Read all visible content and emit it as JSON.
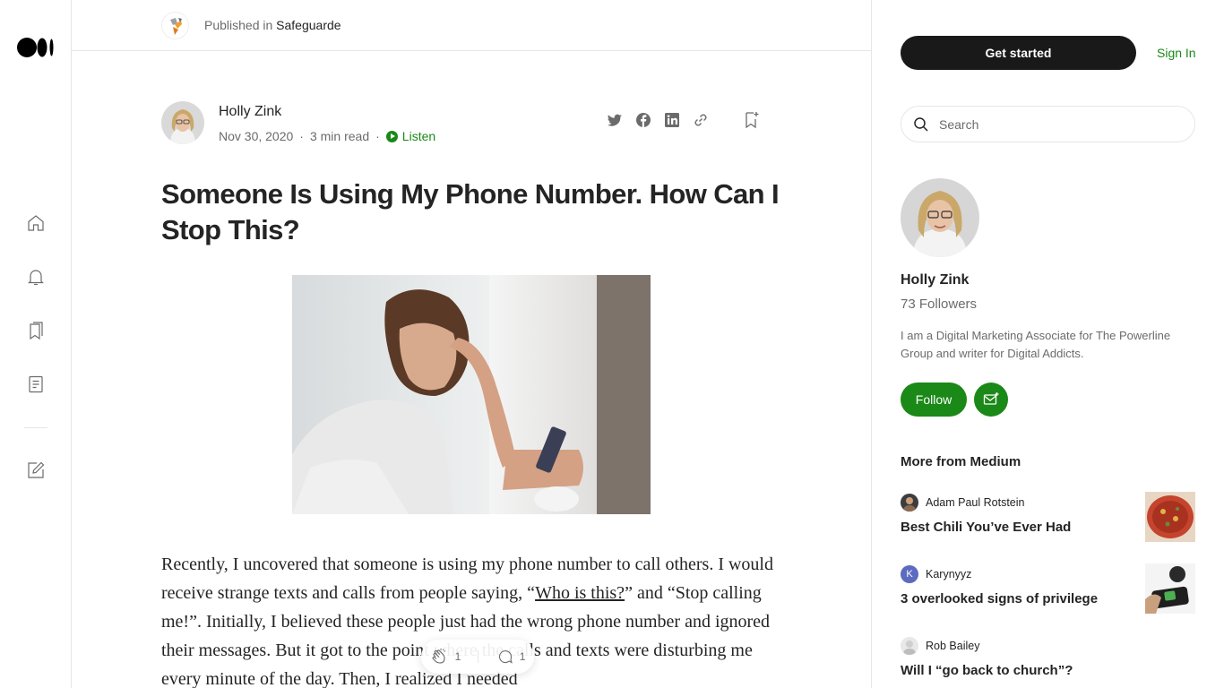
{
  "publication": {
    "prefix": "Published in",
    "name": "Safeguarde"
  },
  "article": {
    "author": "Holly Zink",
    "date": "Nov 30, 2020",
    "read_time": "3 min read",
    "separator": "·",
    "listen_label": "Listen",
    "title": "Someone Is Using My Phone Number. How Can I Stop This?",
    "body_part1": "Recently, I uncovered that someone is using my phone number to call others. I would receive strange texts and calls from people saying, “",
    "body_link": "Who is this?",
    "body_part2": "” and “Stop calling me!”. Initially, I believed these people just had the wrong phone number and ignored their messages. But it got to the point where the calls and texts were disturbing me every minute of the day. Then, I realized I needed",
    "claps": "1",
    "responses": "1"
  },
  "sidebar": {
    "get_started": "Get started",
    "sign_in": "Sign In",
    "search_placeholder": "Search",
    "profile_name": "Holly Zink",
    "followers": "73 Followers",
    "bio": "I am a Digital Marketing Associate for The Powerline Group and writer for Digital Addicts.",
    "follow_label": "Follow",
    "more_heading": "More from Medium",
    "recommendations": [
      {
        "author": "Adam Paul Rotstein",
        "title": "Best Chili You’ve Ever Had"
      },
      {
        "author": "Karynyyz",
        "initial": "K",
        "title": "3 overlooked signs of privilege"
      },
      {
        "author": "Rob Bailey",
        "title": "Will I “go back to church”?"
      }
    ]
  },
  "colors": {
    "accent_green": "#1a8917",
    "dark_button": "#191919",
    "muted_text": "#6b6b6b",
    "border": "#e6e6e6"
  },
  "icons": {
    "rail": [
      "medium-logo-icon",
      "home-icon",
      "notifications-bell-icon",
      "bookmarks-icon",
      "stories-icon",
      "write-icon"
    ],
    "share": [
      "twitter-icon",
      "facebook-icon",
      "linkedin-icon",
      "copy-link-icon"
    ]
  }
}
